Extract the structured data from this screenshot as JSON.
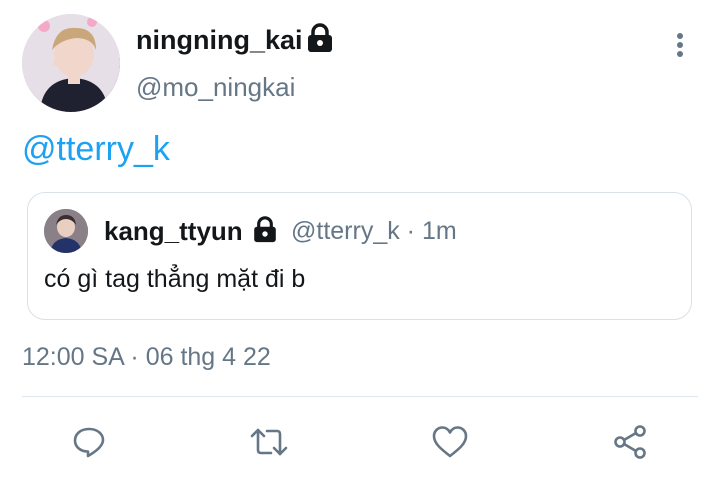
{
  "tweet": {
    "display_name": "ningning_kai",
    "handle": "@mo_ningkai",
    "text": "@tterry_k",
    "timestamp": "12:00 SA · 06 thg 4 22"
  },
  "quoted_tweet": {
    "display_name": "kang_ttyun",
    "handle_time": "@tterry_k · 1m",
    "text": "có gì tag thẳng mặt đi b"
  },
  "icons": {
    "protected": "lock-icon",
    "more": "more-vertical-icon",
    "actions": [
      "reply-icon",
      "retweet-icon",
      "like-icon",
      "share-icon"
    ]
  },
  "colors": {
    "accent": "#1da1f2",
    "secondary_text": "#657786",
    "divider": "#e1e8ed",
    "border": "#d9e1e8"
  }
}
